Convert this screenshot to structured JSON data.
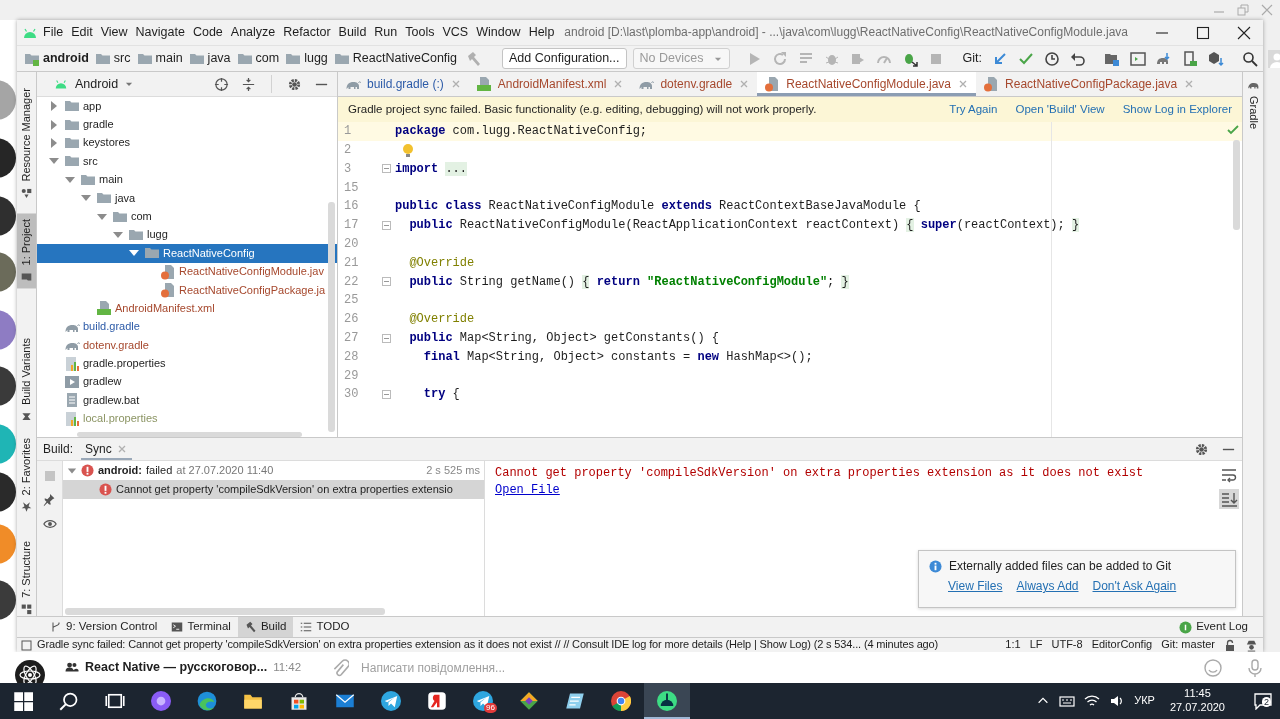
{
  "window": {
    "title": "android [D:\\last\\plomba-app\\android] - ...\\java\\com\\lugg\\ReactNativeConfig\\ReactNativeConfigModule.java"
  },
  "menu": [
    "File",
    "Edit",
    "View",
    "Navigate",
    "Code",
    "Analyze",
    "Refactor",
    "Build",
    "Run",
    "Tools",
    "VCS",
    "Window",
    "Help"
  ],
  "breadcrumbs": [
    {
      "label": "android",
      "kind": "module"
    },
    {
      "label": "src",
      "kind": "folder"
    },
    {
      "label": "main",
      "kind": "folder"
    },
    {
      "label": "java",
      "kind": "folder"
    },
    {
      "label": "com",
      "kind": "folder"
    },
    {
      "label": "lugg",
      "kind": "folder"
    },
    {
      "label": "ReactNativeConfig",
      "kind": "folder"
    }
  ],
  "toolbar": {
    "run_configuration": "Add Configuration...",
    "device": "No Devices",
    "vcs_label": "Git:"
  },
  "tool_windows_left": {
    "top": [
      {
        "label": "Resource Manager",
        "kind": "resources",
        "selected": false
      },
      {
        "label": "1: Project",
        "kind": "project",
        "selected": true
      },
      {
        "label": "Build Variants",
        "kind": "variants",
        "selected": false
      }
    ],
    "bottom": [
      {
        "label": "2: Favorites",
        "kind": "favorites",
        "selected": false
      },
      {
        "label": "7: Structure",
        "kind": "structure",
        "selected": false
      }
    ]
  },
  "tool_windows_right": [
    {
      "label": "Gradle",
      "kind": "gradle",
      "selected": false
    }
  ],
  "project": {
    "view": "Android",
    "tree": [
      {
        "label": "app",
        "kind": "folder",
        "expanded": false,
        "selected": false
      },
      {
        "label": "gradle",
        "kind": "folder",
        "expanded": false,
        "selected": false
      },
      {
        "label": "keystores",
        "kind": "folder",
        "expanded": false,
        "selected": false
      },
      {
        "label": "src",
        "kind": "folder",
        "expanded": true,
        "selected": false,
        "children": [
          {
            "label": "main",
            "kind": "folder",
            "expanded": true,
            "selected": false,
            "children": [
              {
                "label": "java",
                "kind": "folder",
                "expanded": true,
                "selected": false,
                "children": [
                  {
                    "label": "com",
                    "kind": "folder",
                    "expanded": true,
                    "selected": false,
                    "children": [
                      {
                        "label": "lugg",
                        "kind": "folder",
                        "expanded": true,
                        "selected": false,
                        "children": [
                          {
                            "label": "ReactNativeConfig",
                            "kind": "folder",
                            "expanded": true,
                            "selected": true,
                            "children": [
                              {
                                "label": "ReactNativeConfigModule.jav",
                                "kind": "java",
                                "color": "#a6482d",
                                "selected": false
                              },
                              {
                                "label": "ReactNativeConfigPackage.ja",
                                "kind": "java",
                                "color": "#a6482d",
                                "selected": false
                              }
                            ]
                          }
                        ]
                      }
                    ]
                  }
                ]
              },
              {
                "label": "AndroidManifest.xml",
                "kind": "manifest",
                "color": "#a6482d",
                "selected": false
              }
            ]
          }
        ]
      },
      {
        "label": "build.gradle",
        "kind": "gradle",
        "color": "#2d5ba8",
        "selected": false
      },
      {
        "label": "dotenv.gradle",
        "kind": "gradle",
        "color": "#a6482d",
        "selected": false
      },
      {
        "label": "gradle.properties",
        "kind": "properties",
        "selected": false
      },
      {
        "label": "gradlew",
        "kind": "script",
        "selected": false
      },
      {
        "label": "gradlew.bat",
        "kind": "text",
        "selected": false
      },
      {
        "label": "local.properties",
        "kind": "properties",
        "color": "#8b9463",
        "selected": false
      }
    ]
  },
  "editor": {
    "tabs": [
      {
        "label": "build.gradle (:)",
        "kind": "gradle",
        "color": "#2d5ba8",
        "selected": false
      },
      {
        "label": "AndroidManifest.xml",
        "kind": "manifest",
        "color": "#a6482d",
        "selected": false
      },
      {
        "label": "dotenv.gradle",
        "kind": "gradle",
        "color": "#a6482d",
        "selected": false
      },
      {
        "label": "ReactNativeConfigModule.java",
        "kind": "java",
        "color": "#a6482d",
        "selected": true
      },
      {
        "label": "ReactNativeConfigPackage.java",
        "kind": "java",
        "color": "#a6482d",
        "selected": false
      }
    ],
    "banner": {
      "message": "Gradle project sync failed. Basic functionality (e.g. editing, debugging) will not work properly.",
      "actions": [
        "Try Again",
        "Open 'Build' View",
        "Show Log in Explorer"
      ]
    },
    "lines": [
      {
        "number": "1",
        "current": true,
        "fold": false,
        "tokens": [
          {
            "text": "package",
            "kind": "keyword"
          },
          {
            "text": " com.lugg.ReactNativeConfig;",
            "kind": "plain"
          }
        ]
      },
      {
        "number": "2",
        "current": false,
        "fold": false,
        "lightbulb": true
      },
      {
        "number": "3",
        "current": false,
        "fold": true,
        "tokens": [
          {
            "text": "import ",
            "kind": "keyword"
          },
          {
            "text": "...",
            "kind": "folded"
          }
        ]
      },
      {
        "number": "15",
        "current": false,
        "fold": false
      },
      {
        "number": "16",
        "current": false,
        "fold": false,
        "tokens": [
          {
            "text": "public class",
            "kind": "keyword"
          },
          {
            "text": " ReactNativeConfigModule ",
            "kind": "plain"
          },
          {
            "text": "extends",
            "kind": "keyword"
          },
          {
            "text": " ReactContextBaseJavaModule {",
            "kind": "plain"
          }
        ]
      },
      {
        "number": "17",
        "current": false,
        "fold": true,
        "tokens": [
          {
            "text": "  public",
            "kind": "keyword"
          },
          {
            "text": " ReactNativeConfigModule(ReactApplicationContext reactContext) ",
            "kind": "plain"
          },
          {
            "text": "{",
            "kind": "folded"
          },
          {
            "text": " super",
            "kind": "keyword"
          },
          {
            "text": "(reactContext); ",
            "kind": "plain"
          },
          {
            "text": "}",
            "kind": "folded"
          }
        ]
      },
      {
        "number": "20",
        "current": false,
        "fold": false
      },
      {
        "number": "21",
        "current": false,
        "fold": false,
        "tokens": [
          {
            "text": "  @Override",
            "kind": "annotation"
          }
        ]
      },
      {
        "number": "22",
        "current": false,
        "fold": true,
        "tokens": [
          {
            "text": "  public",
            "kind": "keyword"
          },
          {
            "text": " String getName() ",
            "kind": "plain"
          },
          {
            "text": "{",
            "kind": "folded"
          },
          {
            "text": " return ",
            "kind": "keyword"
          },
          {
            "text": "\"ReactNativeConfigModule\"",
            "kind": "string"
          },
          {
            "text": "; ",
            "kind": "plain"
          },
          {
            "text": "}",
            "kind": "folded"
          }
        ]
      },
      {
        "number": "25",
        "current": false,
        "fold": false
      },
      {
        "number": "26",
        "current": false,
        "fold": false,
        "tokens": [
          {
            "text": "  @Override",
            "kind": "annotation"
          }
        ]
      },
      {
        "number": "27",
        "current": false,
        "fold": true,
        "tokens": [
          {
            "text": "  public",
            "kind": "keyword"
          },
          {
            "text": " Map<String, Object> getConstants() {",
            "kind": "plain"
          }
        ]
      },
      {
        "number": "28",
        "current": false,
        "fold": false,
        "tokens": [
          {
            "text": "    final",
            "kind": "keyword"
          },
          {
            "text": " Map<String, Object> constants = ",
            "kind": "plain"
          },
          {
            "text": "new",
            "kind": "keyword"
          },
          {
            "text": " HashMap<>();",
            "kind": "plain"
          }
        ]
      },
      {
        "number": "29",
        "current": false,
        "fold": false
      },
      {
        "number": "30",
        "current": false,
        "fold": true,
        "tokens": [
          {
            "text": "    try",
            "kind": "keyword"
          },
          {
            "text": " {",
            "kind": "plain"
          }
        ]
      }
    ]
  },
  "build": {
    "title": "Build:",
    "tabs": [
      {
        "label": "Sync",
        "selected": true
      }
    ],
    "tree": [
      {
        "name": "android:",
        "status": "failed",
        "when": "at 27.07.2020 11:40",
        "duration": "2 s 525 ms",
        "expanded": true,
        "selected": false,
        "children": [
          {
            "message": "Cannot get property 'compileSdkVersion' on extra properties extensio",
            "selected": true
          }
        ]
      }
    ],
    "console": {
      "error": "Cannot get property 'compileSdkVersion' on extra properties extension as it does not exist",
      "link": "Open File"
    }
  },
  "notification": {
    "message": "Externally added files can be added to Git",
    "actions": [
      "View Files",
      "Always Add",
      "Don't Ask Again"
    ]
  },
  "bottom_tabs": [
    {
      "label": "9: Version Control",
      "kind": "vcs",
      "selected": false
    },
    {
      "label": "Terminal",
      "kind": "terminal",
      "selected": false
    },
    {
      "label": "Build",
      "kind": "build",
      "selected": true
    },
    {
      "label": "TODO",
      "kind": "todo",
      "selected": false
    }
  ],
  "event_log": "Event Log",
  "status_bar": {
    "message": "Gradle sync failed: Cannot get property 'compileSdkVersion' on extra properties extension as it does not exist // // Consult IDE log for more details (Help | Show Log) (2 s 534... (4 minutes ago)",
    "items": [
      "1:1",
      "LF",
      "UTF-8",
      "EditorConfig",
      "Git: master"
    ]
  },
  "chat": {
    "title": "React Native — русскоговор...",
    "time": "11:42",
    "placeholder": "Написати повідомлення..."
  },
  "taskbar": {
    "apps": [
      {
        "kind": "start",
        "active": false
      },
      {
        "kind": "search",
        "active": false
      },
      {
        "kind": "taskview",
        "active": false
      },
      {
        "kind": "assistant",
        "active": false
      },
      {
        "kind": "edge",
        "active": false
      },
      {
        "kind": "explorer",
        "active": false
      },
      {
        "kind": "store",
        "active": false
      },
      {
        "kind": "mail",
        "active": false
      },
      {
        "kind": "telegram",
        "active": false
      },
      {
        "kind": "yandex",
        "active": false
      },
      {
        "kind": "telegram",
        "active": false,
        "badge": "96"
      },
      {
        "kind": "gitkraken",
        "active": false
      },
      {
        "kind": "notes",
        "active": false
      },
      {
        "kind": "chrome",
        "active": false
      },
      {
        "kind": "studio",
        "active": true
      }
    ],
    "language": "УКР",
    "time": "11:45",
    "date": "27.07.2020",
    "notifications": "2"
  }
}
